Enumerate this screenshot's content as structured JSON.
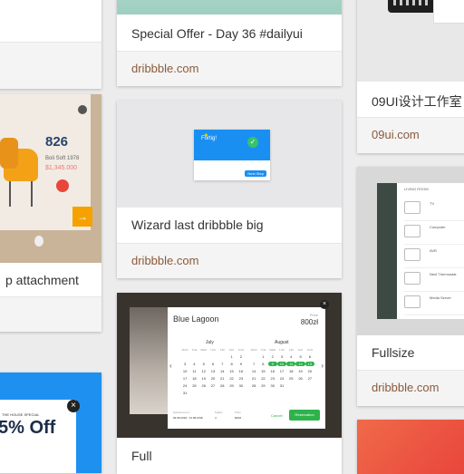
{
  "cards": {
    "c1": {
      "title": "",
      "source": ""
    },
    "c2": {
      "title": "Special Offer - Day 36 #dailyui",
      "source": "dribbble.com"
    },
    "c3": {
      "title": "09UI设计工作室",
      "source": "09ui.com"
    },
    "c4": {
      "title": "p attachment",
      "number": "826",
      "name": "Boli Soft 1978",
      "price": "$1,345.000"
    },
    "c5": {
      "title": "Wizard last dribbble big",
      "source": "dribbble.com",
      "modal_title": "Fortig!",
      "next_label": "Next Step"
    },
    "c6": {
      "title": "Full",
      "hotel_name": "Blue Lagoon",
      "price": "800zł",
      "price_label": "Price",
      "month1": "July",
      "month2": "August",
      "weekdays": [
        "MON",
        "TUE",
        "WED",
        "THU",
        "FRI",
        "SAT",
        "SUN"
      ],
      "july_days": [
        "",
        "",
        "",
        "",
        "",
        "1",
        "2",
        "3",
        "4",
        "5",
        "6",
        "7",
        "8",
        "9",
        "10",
        "11",
        "12",
        "13",
        "14",
        "15",
        "16",
        "17",
        "18",
        "19",
        "20",
        "21",
        "22",
        "23",
        "24",
        "25",
        "26",
        "27",
        "28",
        "29",
        "30",
        "31"
      ],
      "august_days": [
        "",
        "1",
        "2",
        "3",
        "4",
        "5",
        "6",
        "7",
        "8",
        "9",
        "10",
        "11",
        "12",
        "13",
        "14",
        "15",
        "16",
        "17",
        "18",
        "19",
        "20",
        "21",
        "22",
        "23",
        "24",
        "25",
        "26",
        "27",
        "28",
        "29",
        "30",
        "31"
      ],
      "selected_label": "Selected term",
      "selected_value": "09.08.2018 - 13.08.2018",
      "nights_label": "Nights",
      "nights_value": "4",
      "total_label": "Price",
      "total_value": "800zł",
      "cancel_label": "Cancel",
      "reserve_label": "Reservation"
    },
    "c7": {
      "title": "Fullsize",
      "source": "dribbble.com",
      "header": "LIVING ROOM",
      "items": [
        "TV",
        "Computer",
        "AVR",
        "Nest Thermostat",
        "Media Server"
      ]
    },
    "c8": {
      "banner": "5% Off",
      "tagline": "THE HOUSE SPECIAL"
    }
  },
  "colors": {
    "link": "#8a5a3c",
    "accent_orange": "#f5a100",
    "accent_green": "#2db34a",
    "accent_blue": "#1a8ff2"
  }
}
